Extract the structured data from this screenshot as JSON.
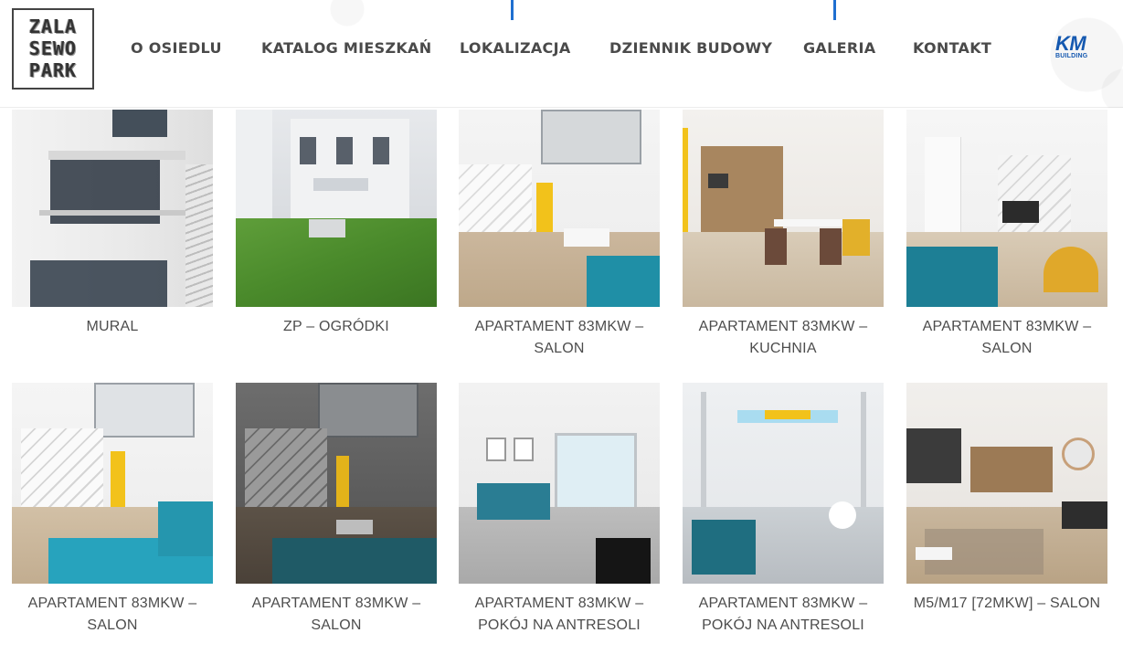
{
  "logo": {
    "lines": [
      "ZALA",
      "SEWO",
      "PARK"
    ]
  },
  "nav": {
    "items": [
      {
        "label": "O OSIEDLU"
      },
      {
        "label": "KATALOG MIESZKAŃ"
      },
      {
        "label": "LOKALIZACJA"
      },
      {
        "label": "DZIENNIK BUDOWY"
      },
      {
        "label": "GALERIA"
      },
      {
        "label": "KONTAKT"
      }
    ],
    "accent_color": "#1f6fd0"
  },
  "brand": {
    "mark": "KM",
    "sub": "BUILDING",
    "color": "#1559b0"
  },
  "gallery": {
    "items": [
      {
        "caption_lines": [
          "MURAL"
        ],
        "scene": "facade-balconies"
      },
      {
        "caption_lines": [
          "ZP – OGRÓDKI"
        ],
        "scene": "garden"
      },
      {
        "caption_lines": [
          "APARTAMENT 83MKW –",
          "SALON"
        ],
        "scene": "living-stairs"
      },
      {
        "caption_lines": [
          "APARTAMENT 83MKW –",
          "KUCHNIA"
        ],
        "scene": "kitchen-dining"
      },
      {
        "caption_lines": [
          "APARTAMENT 83MKW –",
          "SALON"
        ],
        "scene": "living-tv"
      },
      {
        "caption_lines": [
          "APARTAMENT 83MKW –",
          "SALON"
        ],
        "scene": "living-sofa"
      },
      {
        "caption_lines": [
          "APARTAMENT 83MKW –",
          "SALON"
        ],
        "scene": "living-dark"
      },
      {
        "caption_lines": [
          "APARTAMENT 83MKW –",
          "POKÓJ NA ANTRESOLI"
        ],
        "scene": "mezzanine-sofa"
      },
      {
        "caption_lines": [
          "APARTAMENT 83MKW –",
          "POKÓJ NA ANTRESOLI"
        ],
        "scene": "mezzanine-skylight"
      },
      {
        "caption_lines": [
          "M5/M17 [72MKW] – SALON"
        ],
        "scene": "salon-kitchen"
      }
    ]
  }
}
